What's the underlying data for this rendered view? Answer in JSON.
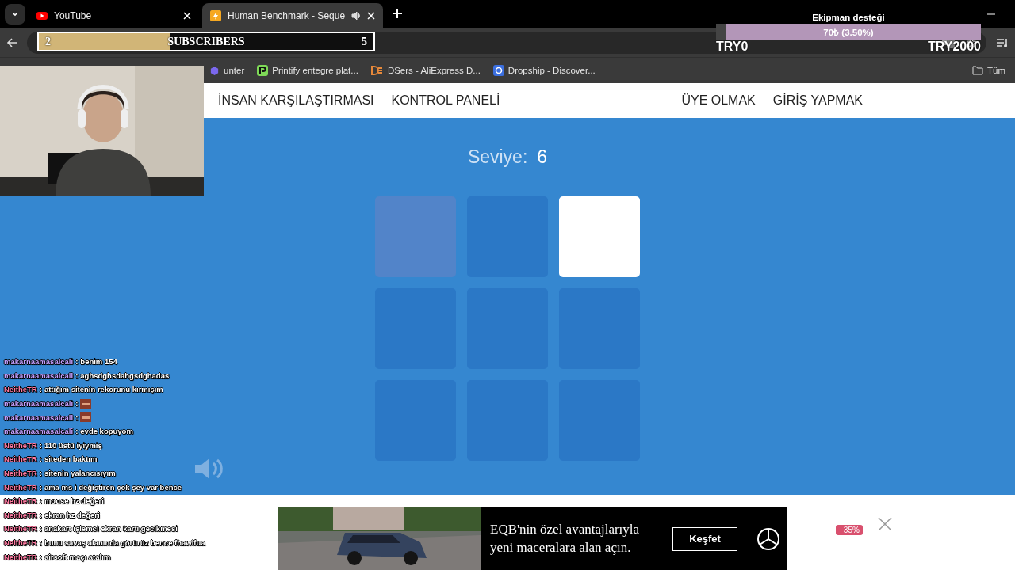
{
  "browser": {
    "tabs": [
      {
        "label": "YouTube",
        "selected": false,
        "kind": "youtube"
      },
      {
        "label": "Human Benchmark - Seque",
        "selected": true,
        "kind": "bolt"
      }
    ],
    "bookmarks": [
      {
        "label": "unter",
        "kind": "hunter"
      },
      {
        "label": "Printify entegre plat...",
        "kind": "printify"
      },
      {
        "label": "DSers - AliExpress D...",
        "kind": "dsers"
      },
      {
        "label": "Dropship - Discover...",
        "kind": "dropship"
      }
    ],
    "all_bookmarks": "Tüm"
  },
  "site": {
    "nav_left": [
      "İNSAN KARŞILAŞTIRMASI",
      "KONTROL PANELİ"
    ],
    "nav_right": [
      "ÜYE OLMAK",
      "GİRİŞ YAPMAK"
    ],
    "level_label": "Seviye:",
    "level_value": "6",
    "grid": [
      {
        "kind": "fading"
      },
      {
        "kind": "idle"
      },
      {
        "kind": "lit"
      },
      {
        "kind": "idle"
      },
      {
        "kind": "idle"
      },
      {
        "kind": "idle"
      },
      {
        "kind": "idle"
      },
      {
        "kind": "idle"
      },
      {
        "kind": "idle"
      }
    ]
  },
  "ad": {
    "headline": "EQB'nin özel avantajlarıyla yeni maceralara alan açın.",
    "button": "Keşfet",
    "badge": "−35%"
  },
  "overlay": {
    "subscribers": {
      "current": "2",
      "label": "SUBSCRIBERS",
      "goal": "5",
      "level": 0.39
    },
    "donation": {
      "title": "Ekipman desteği",
      "amount": "70₺ (3.50%)",
      "level": 0.035,
      "min": "TRY0",
      "max": "TRY2000"
    },
    "chat": [
      {
        "user": "makarnaamasalcali",
        "color": "#c4a0ff",
        "sep": ":",
        "kind": "text",
        "text": "benim 154"
      },
      {
        "user": "makarnaamasalcali",
        "color": "#c4a0ff",
        "sep": ":",
        "kind": "text",
        "text": "aghsdghsdahgsdghadas"
      },
      {
        "user": "NeitheTR",
        "color": "#ff7aa2",
        "sep": ":",
        "kind": "text",
        "text": "attığım sitenin rekorunu kırmışım"
      },
      {
        "user": "makarnaamasalcali",
        "color": "#c4a0ff",
        "sep": ":",
        "kind": "emote"
      },
      {
        "user": "makarnaamasalcali",
        "color": "#c4a0ff",
        "sep": ":",
        "kind": "emote"
      },
      {
        "user": "makarnaamasalcali",
        "color": "#c4a0ff",
        "sep": ":",
        "kind": "text",
        "text": "evde kopuyom"
      },
      {
        "user": "NeitheTR",
        "color": "#ff7aa2",
        "sep": ":",
        "kind": "text",
        "text": "110 üstü iyiymiş"
      },
      {
        "user": "NeitheTR",
        "color": "#ff7aa2",
        "sep": ":",
        "kind": "text",
        "text": "siteden baktım"
      },
      {
        "user": "NeitheTR",
        "color": "#ff7aa2",
        "sep": ":",
        "kind": "text",
        "text": "sitenin yalancısıyım"
      },
      {
        "user": "NeitheTR",
        "color": "#ff7aa2",
        "sep": ":",
        "kind": "text",
        "text": "ama ms i değiştiren çok şey var bence"
      },
      {
        "user": "NeitheTR",
        "color": "#ff7aa2",
        "sep": ":",
        "kind": "text",
        "text": "mouse hz değeri"
      },
      {
        "user": "NeitheTR",
        "color": "#ff7aa2",
        "sep": ":",
        "kind": "text",
        "text": "ekran hz değeri"
      },
      {
        "user": "NeitheTR",
        "color": "#ff7aa2",
        "sep": ":",
        "kind": "text",
        "text": "anakart işlemci ekran kartı gecikmesi"
      },
      {
        "user": "NeitheTR",
        "color": "#ff7aa2",
        "sep": ":",
        "kind": "text",
        "text": "bunu savaş alanında görürüz bence fhawifua"
      },
      {
        "user": "NeitheTR",
        "color": "#ff7aa2",
        "sep": ":",
        "kind": "text",
        "text": "airsoft maçı atalım"
      }
    ]
  }
}
